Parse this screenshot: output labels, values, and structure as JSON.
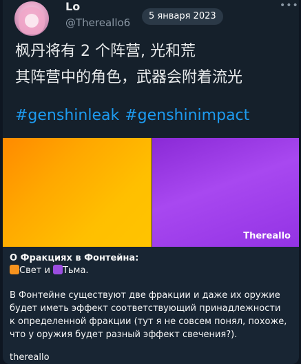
{
  "tweet": {
    "author_name": "Lo",
    "author_handle": "@Thereallo6",
    "date": "5 января 2023",
    "more_icon": "more-dots-icon",
    "lines": [
      "枫丹将有 2 个阵营, 光和荒",
      "其阵营中的角色，武器会附着流光"
    ],
    "hashtags": [
      "#genshinleak",
      "#genshinimpact"
    ]
  },
  "media": {
    "watermark": "Thereallo",
    "left_color": "#ffb000",
    "right_color": "#9b3de8"
  },
  "caption": {
    "title": "О Фракциях в Фонтейна:",
    "faction_light": "Свет и ",
    "faction_dark": "Тьма.",
    "body": "В Фонтейне существуют две фракции и даже их оружие будет иметь эффект соответствующий принадлежности к определенной фракции (тут я не совсем понял, похоже, что у оружия будет разный эффект свечения?).",
    "signature": "thereallo"
  },
  "colors": {
    "background": "#0e1621",
    "bubble": "#182533",
    "tweet_bg": "#15202b",
    "hashtag": "#1d9bf0"
  }
}
